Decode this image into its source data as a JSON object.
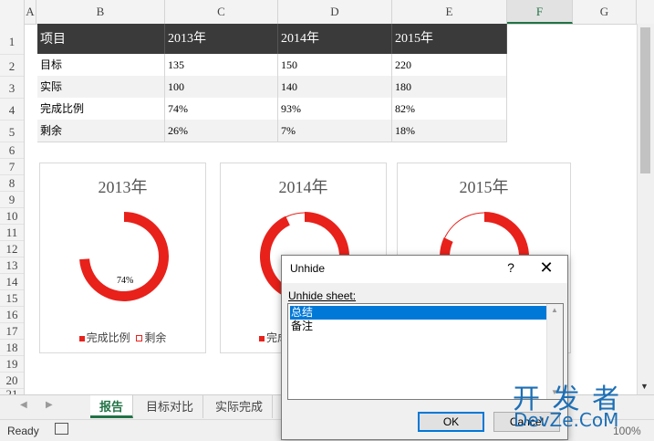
{
  "sheet": {
    "columns": [
      "A",
      "B",
      "C",
      "D",
      "E",
      "F",
      "G"
    ],
    "selected_column": "F",
    "rows": [
      "1",
      "2",
      "3",
      "4",
      "5",
      "6",
      "7",
      "8",
      "9",
      "10",
      "11",
      "12",
      "13",
      "14",
      "15",
      "16",
      "17",
      "18",
      "19",
      "20",
      "21"
    ]
  },
  "table": {
    "header": [
      "项目",
      "2013年",
      "2014年",
      "2015年"
    ],
    "rows": [
      [
        "目标",
        "135",
        "150",
        "220"
      ],
      [
        "实际",
        "100",
        "140",
        "180"
      ],
      [
        "完成比例",
        "74%",
        "93%",
        "82%"
      ],
      [
        "剩余",
        "26%",
        "7%",
        "18%"
      ]
    ]
  },
  "charts": [
    {
      "title": "2013年",
      "completed": 0.74,
      "label": "74%"
    },
    {
      "title": "2014年",
      "completed": 0.93,
      "label": ""
    },
    {
      "title": "2015年",
      "completed": 0.82,
      "label": ""
    }
  ],
  "legend": {
    "completed": "完成比例",
    "remaining": "剩余",
    "partial": "完成"
  },
  "colors": {
    "accent": "#e8211b",
    "header_bg": "#3a3a3a",
    "excel_green": "#217346",
    "selection": "#0078d7"
  },
  "tabs": [
    "报告",
    "目标对比",
    "实际完成"
  ],
  "active_tab": "报告",
  "status": {
    "ready": "Ready",
    "zoom": "100%"
  },
  "dialog": {
    "title": "Unhide",
    "help": "?",
    "close": "✕",
    "label": "Unhide sheet:",
    "sheets": [
      "总结",
      "备注"
    ],
    "selected_sheet": "总结",
    "ok": "OK",
    "cancel": "Cancel"
  },
  "watermark": {
    "line1": "开 发 者",
    "line2": "DevZe.CoM"
  }
}
